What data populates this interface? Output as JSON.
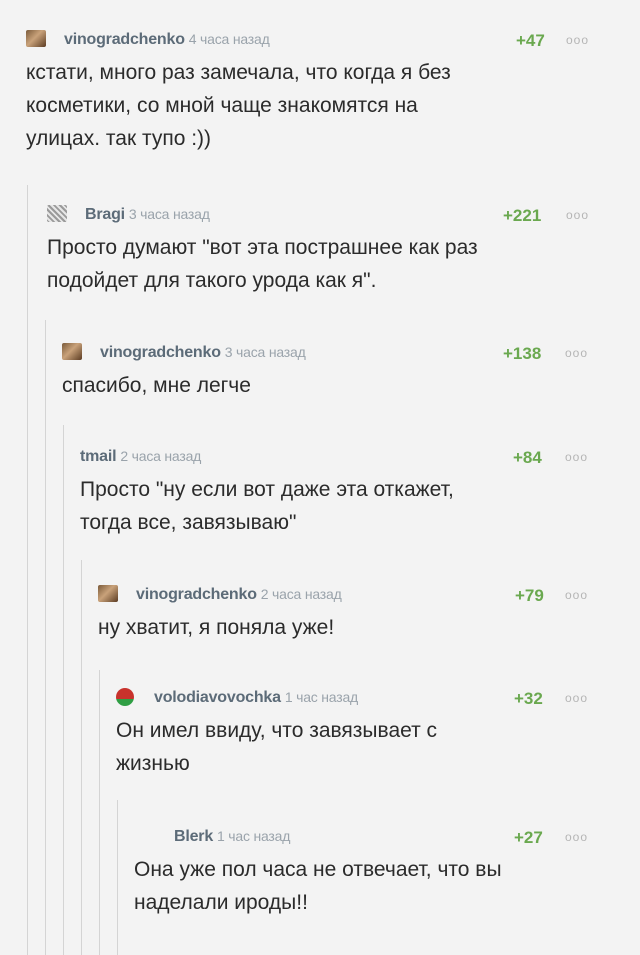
{
  "comments": [
    {
      "user": "vinogradchenko",
      "time": "4 часа назад",
      "rating": "+47",
      "dots": "ooo",
      "avatar": "photo-avatar",
      "text": "кстати, много раз замечала, что когда я без\nкосметики, со мной чаще знакомятся на\nулицах. так тупо :))"
    },
    {
      "user": "Bragi",
      "time": "3 часа назад",
      "rating": "+221",
      "dots": "ooo",
      "avatar": "sketch-avatar",
      "text": "Просто думают \"вот эта пострашнее как раз\nподойдет для такого урода как я\"."
    },
    {
      "user": "vinogradchenko",
      "time": "3 часа назад",
      "rating": "+138",
      "dots": "ooo",
      "avatar": "photo-avatar",
      "text": "спасибо, мне легче"
    },
    {
      "user": "tmail",
      "time": "2 часа назад",
      "rating": "+84",
      "dots": "ooo",
      "avatar": "",
      "text": "Просто \"ну если вот даже эта откажет,\nтогда все, завязываю\""
    },
    {
      "user": "vinogradchenko",
      "time": "2 часа назад",
      "rating": "+79",
      "dots": "ooo",
      "avatar": "photo-avatar",
      "text": "ну хватит, я поняла уже!"
    },
    {
      "user": "volodiavovochka",
      "time": "1 час назад",
      "rating": "+32",
      "dots": "ooo",
      "avatar": "flag-avatar",
      "text": "Он имел ввиду, что завязывает с\nжизнью"
    },
    {
      "user": "Blerk",
      "time": "1 час назад",
      "rating": "+27",
      "dots": "ooo",
      "avatar": "",
      "text": "Она уже пол часа не отвечает, что вы\nнаделали ироды!!"
    }
  ]
}
